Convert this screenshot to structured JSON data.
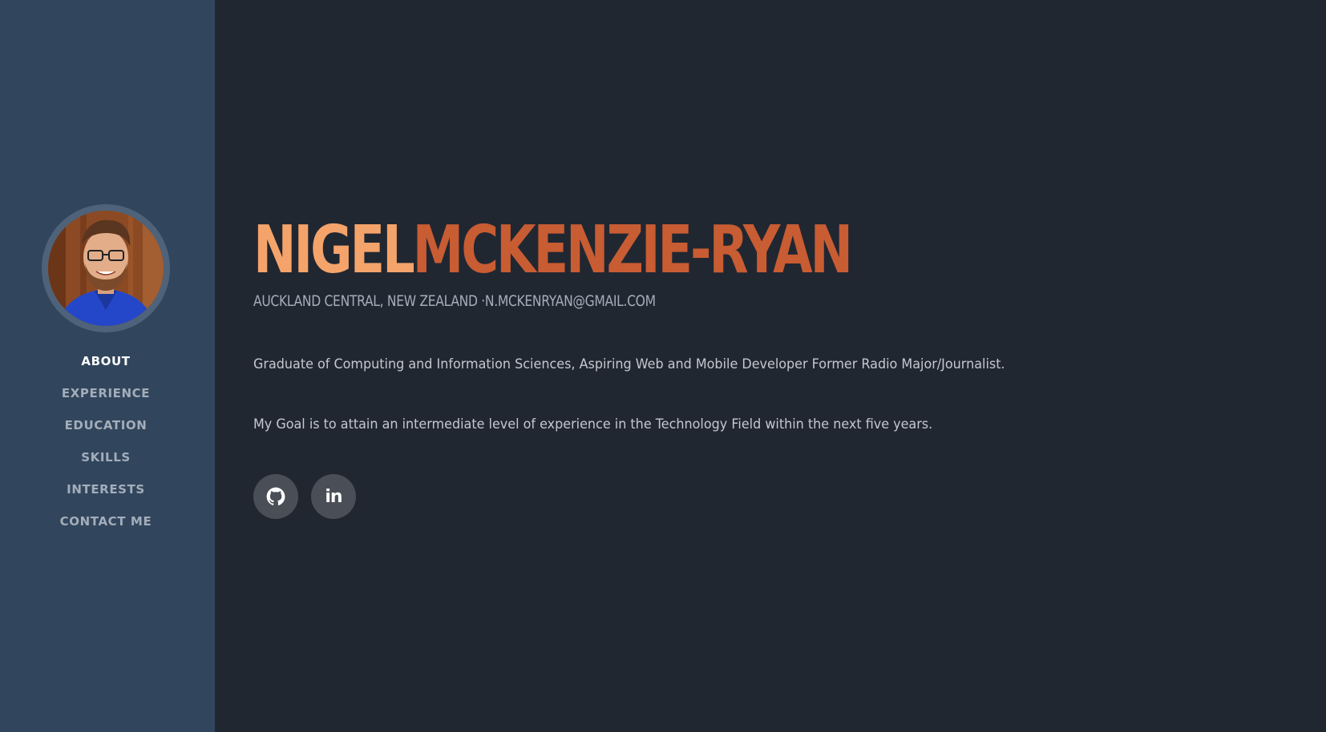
{
  "profile": {
    "first_name": "NIGEL",
    "last_name": "MCKENZIE-RYAN",
    "location": "AUCKLAND CENTRAL, NEW ZEALAND ·",
    "email": "N.MCKENRYAN@GMAIL.COM",
    "summary": "Graduate of Computing and Information Sciences, Aspiring Web and Mobile Developer Former Radio Major/Journalist.",
    "goal": "My Goal is to attain an intermediate level of experience in the Technology Field within the next five years."
  },
  "sidebar": {
    "nav": [
      {
        "label": "ABOUT",
        "active": true
      },
      {
        "label": "EXPERIENCE",
        "active": false
      },
      {
        "label": "EDUCATION",
        "active": false
      },
      {
        "label": "SKILLS",
        "active": false
      },
      {
        "label": "INTERESTS",
        "active": false
      },
      {
        "label": "CONTACT ME",
        "active": false
      }
    ]
  },
  "social": {
    "github_icon": "github-icon",
    "linkedin_label": "in"
  },
  "colors": {
    "sidebar_bg": "#31465d",
    "main_bg": "#212731",
    "first_name": "#f4a36a",
    "last_name": "#c85c33"
  }
}
